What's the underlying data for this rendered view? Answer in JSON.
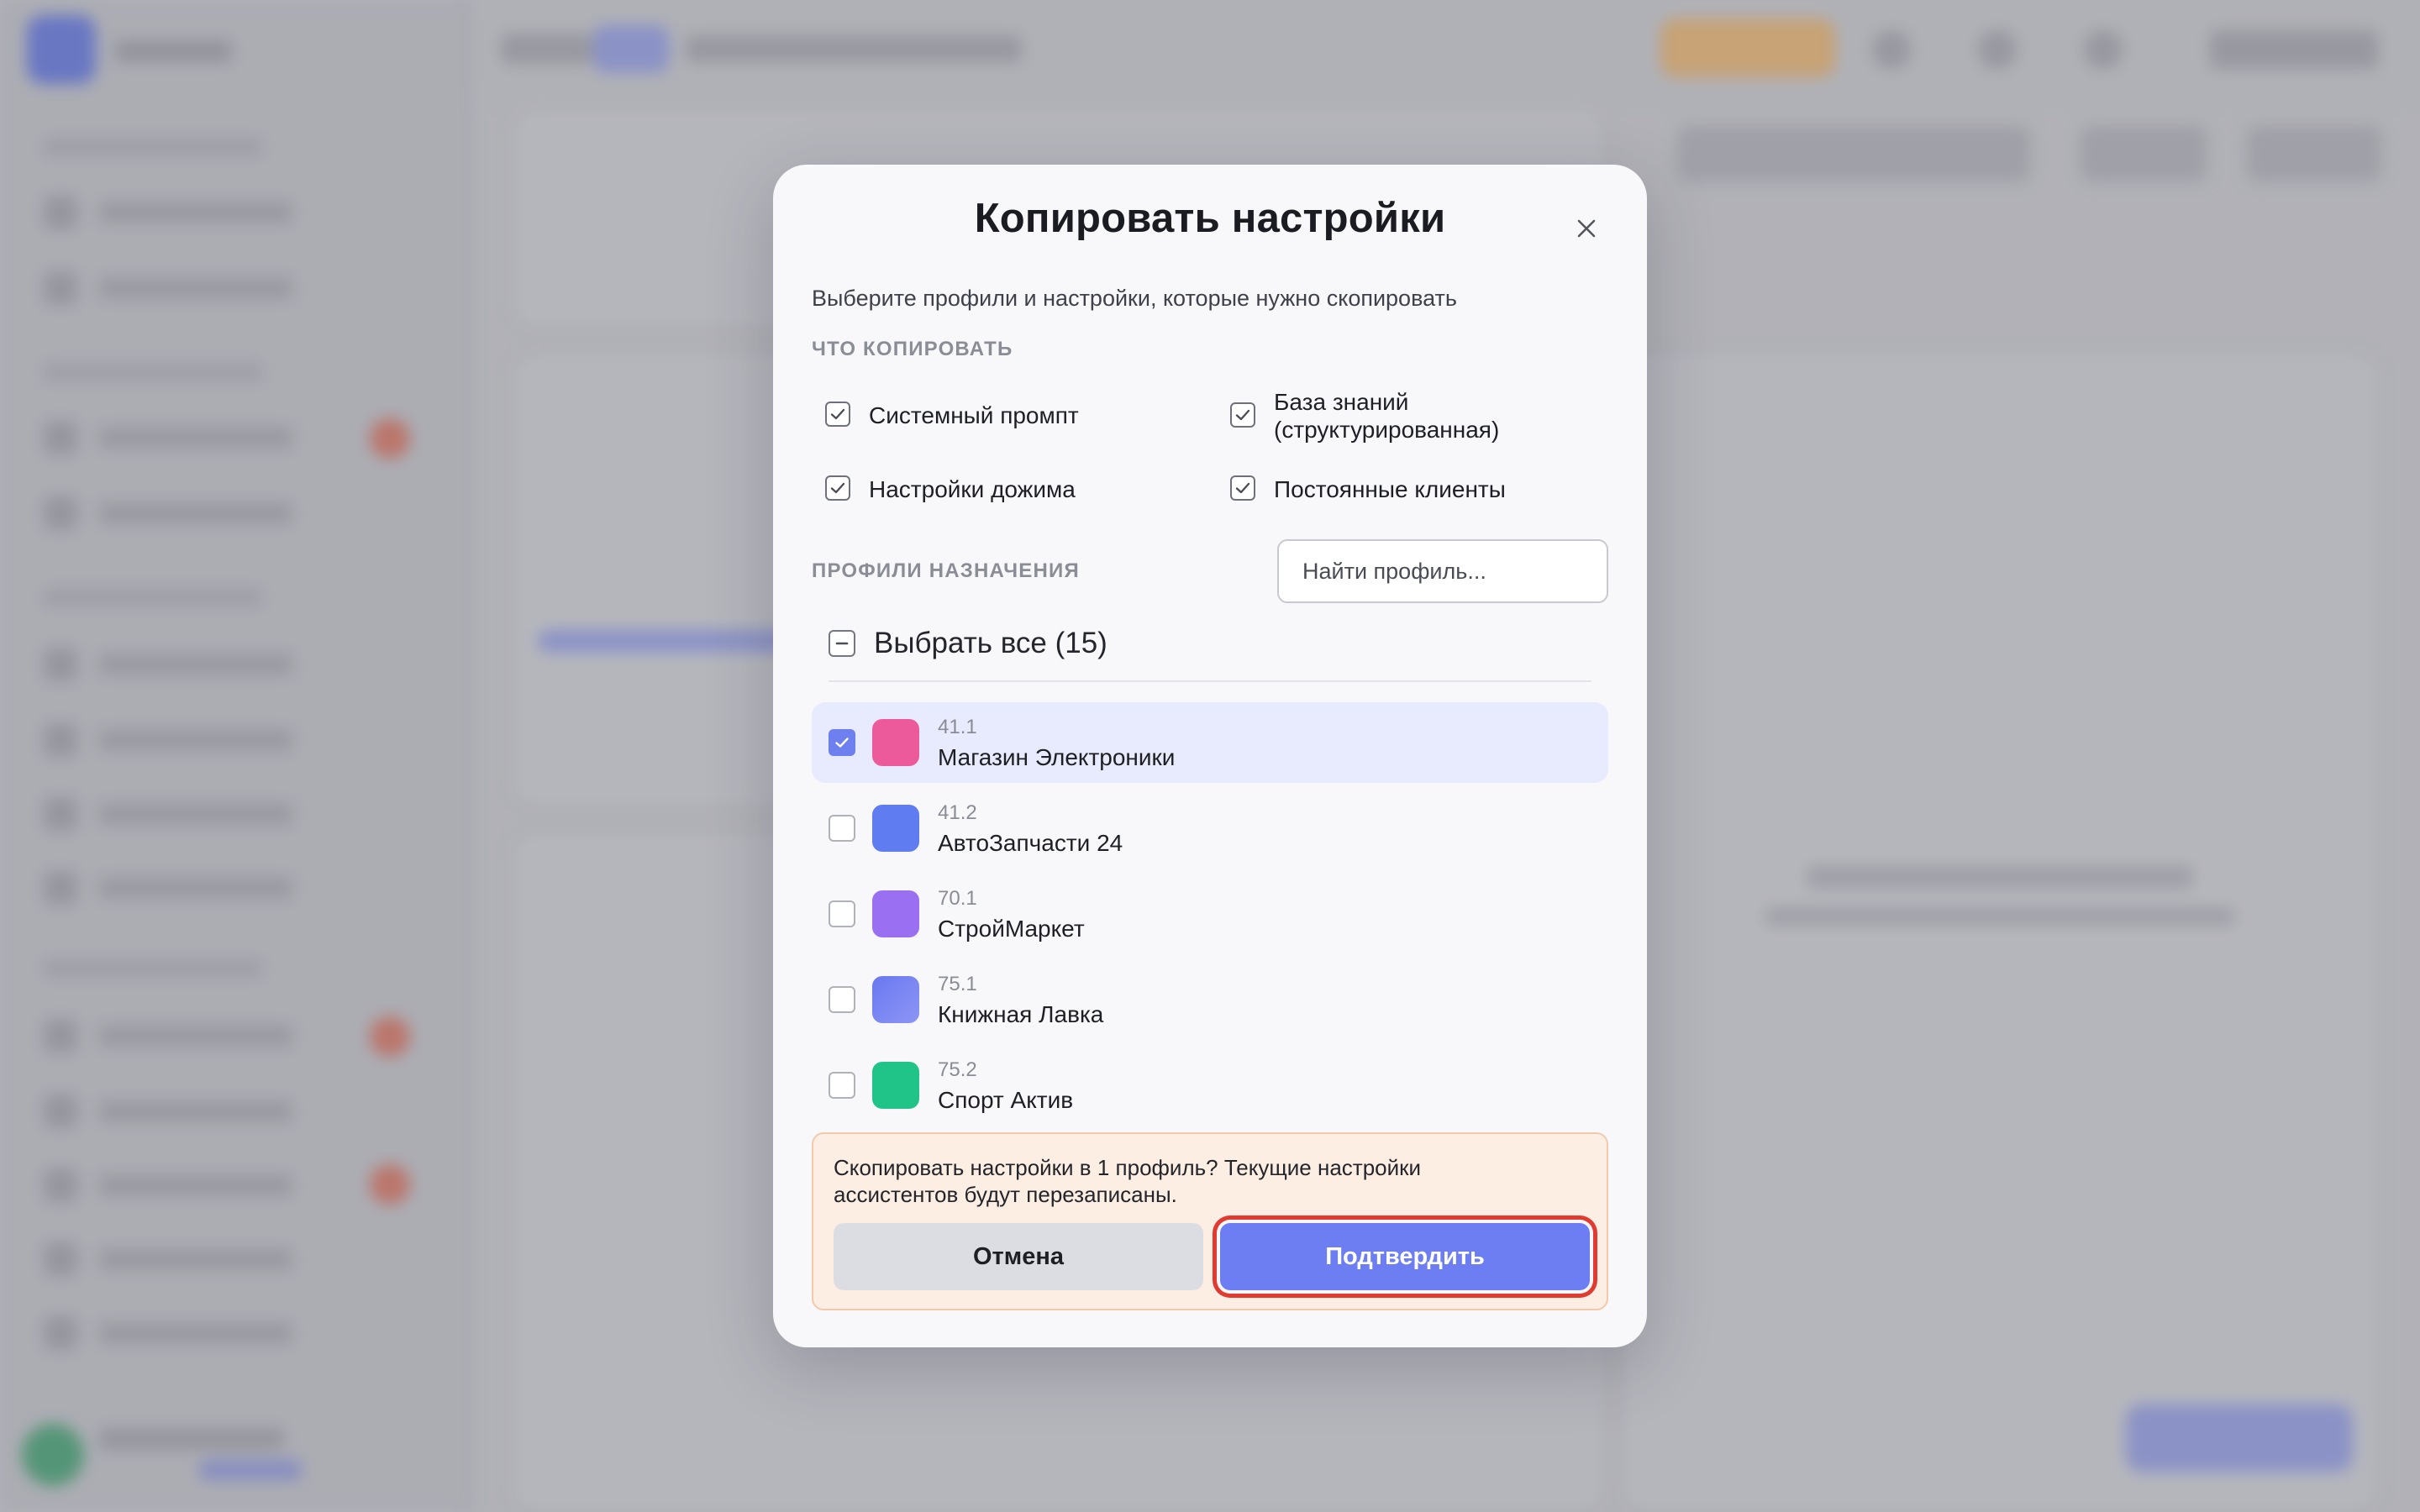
{
  "modal": {
    "title": "Копировать настройки",
    "subtitle": "Выберите профили и настройки, которые нужно скопировать",
    "what_to_copy_label": "ЧТО КОПИРОВАТЬ",
    "options": [
      {
        "label": "Системный промпт",
        "checked": true
      },
      {
        "label": "База знаний (структурированная)",
        "checked": true
      },
      {
        "label": "Настройки дожима",
        "checked": true
      },
      {
        "label": "Постоянные клиенты",
        "checked": true
      }
    ],
    "target_profiles_label": "ПРОФИЛИ НАЗНАЧЕНИЯ",
    "search": {
      "placeholder": "Найти профиль...",
      "value": ""
    },
    "select_all_label": "Выбрать все (15)",
    "profiles": [
      {
        "id": "41.1",
        "name": "Магазин Электроники",
        "selected": true,
        "color": "#ec5a9b"
      },
      {
        "id": "41.2",
        "name": "АвтоЗапчасти 24",
        "selected": false,
        "color": "#5f7cf0"
      },
      {
        "id": "70.1",
        "name": "СтройМаркет",
        "selected": false,
        "color": "#9a6ff2"
      },
      {
        "id": "75.1",
        "name": "Книжная Лавка",
        "selected": false,
        "color": "#7383f2"
      },
      {
        "id": "75.2",
        "name": "Спорт Актив",
        "selected": false,
        "color": "#20c489"
      }
    ],
    "confirm": {
      "text": "Скопировать настройки в 1 профиль? Текущие настройки ассистентов будут перезаписаны.",
      "cancel_label": "Отмена",
      "confirm_label": "Подтвердить"
    }
  },
  "colors": {
    "accent": "#6c7ef1",
    "selected_row": "#e8eafd",
    "warning_bg": "#fdeee4",
    "focus_ring": "#e13a31"
  }
}
